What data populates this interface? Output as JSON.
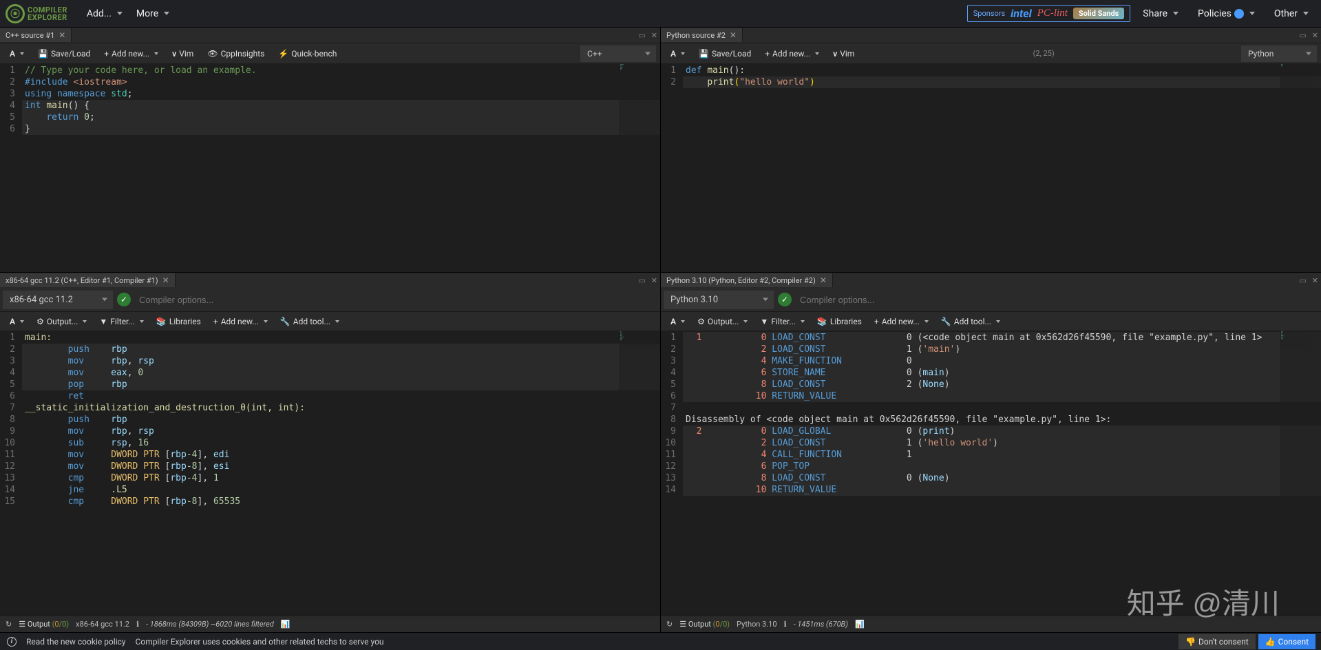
{
  "header": {
    "logo_top": "COMPILER",
    "logo_bottom": "EXPLORER",
    "add": "Add...",
    "more": "More",
    "sponsors_label": "Sponsors",
    "intel": "intel",
    "pclint": "PC-lint",
    "solidsands": "Solid Sands",
    "share": "Share",
    "policies": "Policies",
    "other": "Other"
  },
  "panels": {
    "cpp_source": {
      "tab": "C++ source #1",
      "save_load": "Save/Load",
      "add_new": "Add new...",
      "vim": "Vim",
      "cppinsights": "CppInsights",
      "quickbench": "Quick-bench",
      "language": "C++",
      "lines": [
        {
          "n": "1",
          "html": "<span class='c-comment'>// Type your code here, or load an example.</span>"
        },
        {
          "n": "2",
          "html": "<span class='c-keyword'>#include</span> <span class='c-string'>&lt;iostream&gt;</span>"
        },
        {
          "n": "3",
          "html": "<span class='c-keyword'>using</span> <span class='c-keyword'>namespace</span> <span class='c-ident'>std</span><span class='c-white'>;</span>"
        },
        {
          "n": "4",
          "html": "<span class='c-type'>int</span> <span class='c-func'>main</span><span class='c-white'>()</span> <span class='c-white'>{</span>",
          "hl": true
        },
        {
          "n": "5",
          "html": "    <span class='c-keyword'>return</span> <span class='c-num'>0</span><span class='c-white'>;</span>",
          "hl": true
        },
        {
          "n": "6",
          "html": "<span class='c-white'>}</span>",
          "hl": true
        }
      ]
    },
    "py_source": {
      "tab": "Python source #2",
      "save_load": "Save/Load",
      "add_new": "Add new...",
      "vim": "Vim",
      "cursor": "(2, 25)",
      "language": "Python",
      "lines": [
        {
          "n": "1",
          "html": "<span class='c-keyword'>def</span> <span class='c-func'>main</span><span class='c-white'>():</span>"
        },
        {
          "n": "2",
          "html": "    <span class='c-func'>print</span><span class='c-paren'>(</span><span class='c-string'>\"hello world\"</span><span class='c-paren'>)</span>",
          "hl": true
        }
      ]
    },
    "cpp_out": {
      "tab": "x86-64 gcc 11.2 (C++, Editor #1, Compiler #1)",
      "compiler": "x86-64 gcc 11.2",
      "opts_placeholder": "Compiler options...",
      "output": "Output...",
      "filter": "Filter...",
      "libraries": "Libraries",
      "add_new": "Add new...",
      "add_tool": "Add tool...",
      "lines": [
        {
          "n": "1",
          "html": "<span class='c-label'>main:</span>"
        },
        {
          "n": "2",
          "html": "        <span class='c-op'>push</span>    <span class='c-reg'>rbp</span>",
          "hl": true
        },
        {
          "n": "3",
          "html": "        <span class='c-op'>mov</span>     <span class='c-reg'>rbp</span><span class='c-white'>,</span> <span class='c-reg'>rsp</span>",
          "hl": true
        },
        {
          "n": "4",
          "html": "        <span class='c-op'>mov</span>     <span class='c-reg'>eax</span><span class='c-white'>,</span> <span class='c-num'>0</span>",
          "hl": true
        },
        {
          "n": "5",
          "html": "        <span class='c-op'>pop</span>     <span class='c-reg'>rbp</span>",
          "hl": true
        },
        {
          "n": "6",
          "html": "        <span class='c-op'>ret</span>"
        },
        {
          "n": "7",
          "html": "<span class='c-label'>__static_initialization_and_destruction_0(int, int):</span>"
        },
        {
          "n": "8",
          "html": "        <span class='c-op'>push</span>    <span class='c-reg'>rbp</span>"
        },
        {
          "n": "9",
          "html": "        <span class='c-op'>mov</span>     <span class='c-reg'>rbp</span><span class='c-white'>,</span> <span class='c-reg'>rsp</span>"
        },
        {
          "n": "10",
          "html": "        <span class='c-op'>sub</span>     <span class='c-reg'>rsp</span><span class='c-white'>,</span> <span class='c-num'>16</span>"
        },
        {
          "n": "11",
          "html": "        <span class='c-op'>mov</span>     <span class='c-mem'>DWORD PTR</span> <span class='c-white'>[</span><span class='c-reg'>rbp</span><span class='c-num'>-4</span><span class='c-white'>],</span> <span class='c-reg'>edi</span>"
        },
        {
          "n": "12",
          "html": "        <span class='c-op'>mov</span>     <span class='c-mem'>DWORD PTR</span> <span class='c-white'>[</span><span class='c-reg'>rbp</span><span class='c-num'>-8</span><span class='c-white'>],</span> <span class='c-reg'>esi</span>"
        },
        {
          "n": "13",
          "html": "        <span class='c-op'>cmp</span>     <span class='c-mem'>DWORD PTR</span> <span class='c-white'>[</span><span class='c-reg'>rbp</span><span class='c-num'>-4</span><span class='c-white'>],</span> <span class='c-num'>1</span>"
        },
        {
          "n": "14",
          "html": "        <span class='c-op'>jne</span>     <span class='c-label'>.L5</span>"
        },
        {
          "n": "15",
          "html": "        <span class='c-op'>cmp</span>     <span class='c-mem'>DWORD PTR</span> <span class='c-white'>[</span><span class='c-reg'>rbp</span><span class='c-num'>-8</span><span class='c-white'>],</span> <span class='c-num'>65535</span>"
        }
      ],
      "status": {
        "output_label": "Output",
        "counts": "(0/0)",
        "compiler": "x86-64 gcc 11.2",
        "timing": "- 1868ms (84309B) ~6020 lines filtered"
      }
    },
    "py_out": {
      "tab": "Python 3.10 (Python, Editor #2, Compiler #2)",
      "compiler": "Python 3.10",
      "opts_placeholder": "Compiler options...",
      "output": "Output...",
      "filter": "Filter...",
      "libraries": "Libraries",
      "add_new": "Add new...",
      "add_tool": "Add tool...",
      "lines": [
        {
          "n": "1",
          "html": "  <span class='c-red'>1</span>           <span class='c-red'>0</span> <span class='c-op'>LOAD_CONST</span>               <span class='c-white'>0</span> <span class='c-white'>(&lt;code object main at 0x562d26f45590, file \"example.py\", line 1&gt;</span>",
          "hl": true
        },
        {
          "n": "2",
          "html": "              <span class='c-red'>2</span> <span class='c-op'>LOAD_CONST</span>               <span class='c-white'>1</span> <span class='c-white'>(</span><span class='c-string'>'main'</span><span class='c-white'>)</span>",
          "hl": true
        },
        {
          "n": "3",
          "html": "              <span class='c-red'>4</span> <span class='c-op'>MAKE_FUNCTION</span>            <span class='c-white'>0</span>",
          "hl": true
        },
        {
          "n": "4",
          "html": "              <span class='c-red'>6</span> <span class='c-op'>STORE_NAME</span>               <span class='c-white'>0</span> <span class='c-white'>(</span><span class='c-reg'>main</span><span class='c-white'>)</span>",
          "hl": true
        },
        {
          "n": "5",
          "html": "              <span class='c-red'>8</span> <span class='c-op'>LOAD_CONST</span>               <span class='c-white'>2</span> <span class='c-white'>(</span><span class='c-reg'>None</span><span class='c-white'>)</span>",
          "hl": true
        },
        {
          "n": "6",
          "html": "             <span class='c-red'>10</span> <span class='c-op'>RETURN_VALUE</span>",
          "hl": true
        },
        {
          "n": "7",
          "html": ""
        },
        {
          "n": "8",
          "html": "<span class='c-white'>Disassembly of &lt;code object main at 0x562d26f45590, file \"example.py\", line 1&gt;:</span>"
        },
        {
          "n": "9",
          "html": "  <span class='c-red'>2</span>           <span class='c-red'>0</span> <span class='c-op'>LOAD_GLOBAL</span>              <span class='c-white'>0</span> <span class='c-white'>(</span><span class='c-reg'>print</span><span class='c-white'>)</span>",
          "hl": true
        },
        {
          "n": "10",
          "html": "              <span class='c-red'>2</span> <span class='c-op'>LOAD_CONST</span>               <span class='c-white'>1</span> <span class='c-white'>(</span><span class='c-string'>'hello world'</span><span class='c-white'>)</span>",
          "hl": true
        },
        {
          "n": "11",
          "html": "              <span class='c-red'>4</span> <span class='c-op'>CALL_FUNCTION</span>            <span class='c-white'>1</span>",
          "hl": true
        },
        {
          "n": "12",
          "html": "              <span class='c-red'>6</span> <span class='c-op'>POP_TOP</span>",
          "hl": true
        },
        {
          "n": "13",
          "html": "              <span class='c-red'>8</span> <span class='c-op'>LOAD_CONST</span>               <span class='c-white'>0</span> <span class='c-white'>(</span><span class='c-reg'>None</span><span class='c-white'>)</span>",
          "hl": true
        },
        {
          "n": "14",
          "html": "             <span class='c-red'>10</span> <span class='c-op'>RETURN_VALUE</span>",
          "hl": true
        }
      ],
      "status": {
        "output_label": "Output",
        "counts": "(0/0)",
        "compiler": "Python 3.10",
        "timing": "- 1451ms (670B)"
      }
    }
  },
  "cookie": {
    "read": "Read the new cookie policy",
    "text": "Compiler Explorer uses cookies and other related techs to serve you",
    "dont": "Don't consent",
    "consent": "Consent"
  },
  "watermark": "知乎 @清川"
}
